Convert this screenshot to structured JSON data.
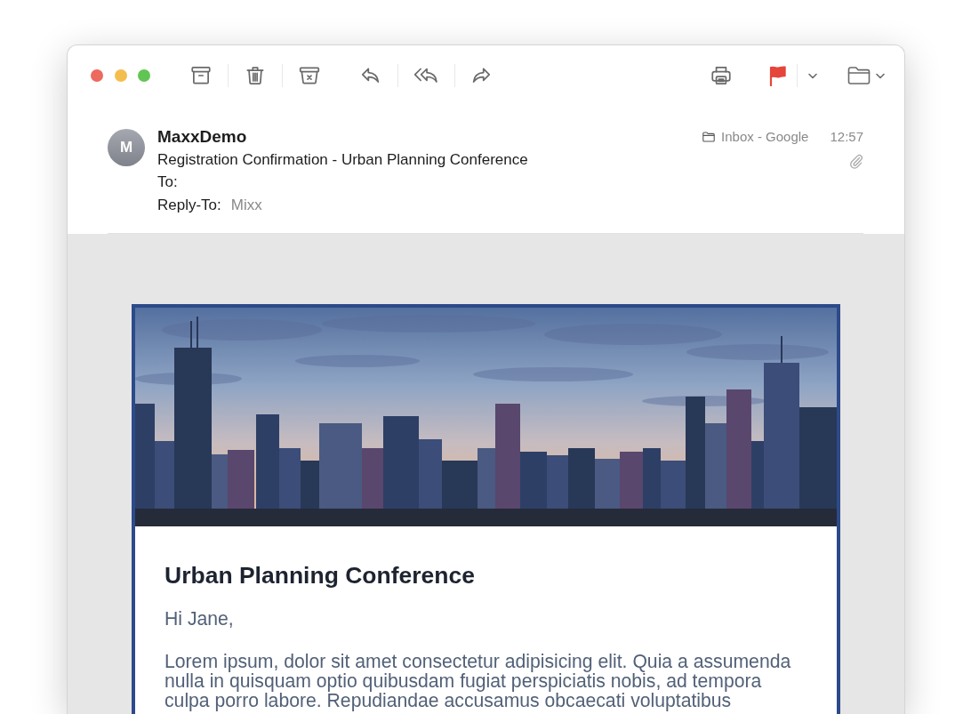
{
  "toolbar": {
    "flagged": true
  },
  "message": {
    "avatar_initial": "M",
    "sender": "MaxxDemo",
    "subject": "Registration Confirmation - Urban Planning Conference",
    "to_label": "To:",
    "reply_to_label": "Reply-To:",
    "reply_to": "Mixx",
    "mailbox": "Inbox - Google",
    "time": "12:57",
    "has_attachment": true
  },
  "email_body": {
    "heading": "Urban Planning Conference",
    "greeting": "Hi Jane,",
    "paragraph": "Lorem ipsum, dolor sit amet consectetur adipisicing elit. Quia a assumenda nulla in quisquam optio quibusdam fugiat perspiciatis nobis, ad tempora culpa porro labore. Repudiandae accusamus obcaecati voluptatibus"
  }
}
